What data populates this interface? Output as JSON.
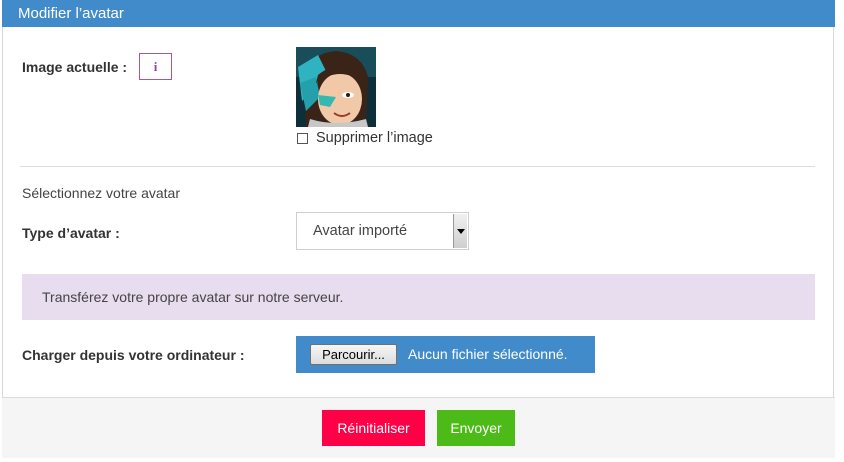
{
  "panel": {
    "title": "Modifier l’avatar"
  },
  "current_image": {
    "label": "Image actuelle :",
    "info_icon": "info-icon",
    "info_glyph": "i",
    "delete_checkbox_label": "Supprimer l’image",
    "delete_checked": false
  },
  "select_section": {
    "title": "Sélectionnez votre avatar"
  },
  "avatar_type": {
    "label": "Type d’avatar :",
    "selected": "Avatar importé"
  },
  "upload_info": {
    "text": "Transférez votre propre avatar sur notre serveur."
  },
  "upload": {
    "label": "Charger depuis votre ordinateur :",
    "browse_label": "Parcourir...",
    "status": "Aucun fichier sélectionné."
  },
  "actions": {
    "reset_label": "Réinitialiser",
    "submit_label": "Envoyer"
  },
  "colors": {
    "header": "#428bca",
    "info_box": "#e8dcef",
    "reset": "#ff0046",
    "submit": "#4cbb17"
  }
}
